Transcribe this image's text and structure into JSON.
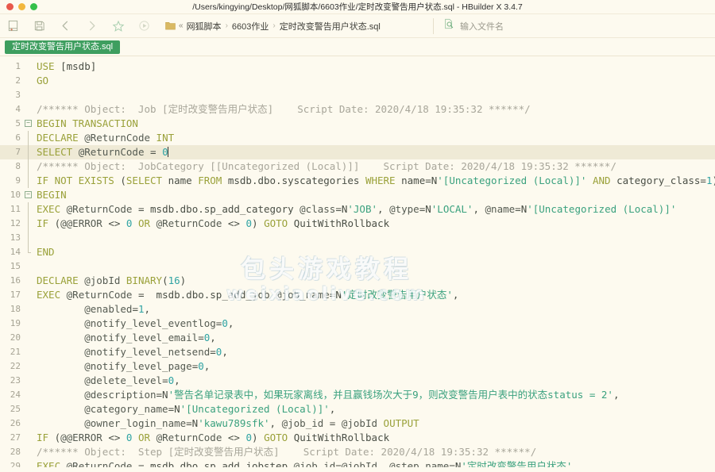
{
  "window": {
    "title": "/Users/kingying/Desktop/网狐脚本/6603作业/定时改变警告用户状态.sql - HBuilder X 3.4.7",
    "traffic_lights": [
      "close",
      "minimize",
      "zoom"
    ],
    "colors": {
      "close": "#e8584b",
      "minimize": "#f2b73d",
      "zoom": "#35c04a",
      "background": "#fdfaef",
      "tab_accent": "#3e9e5f",
      "current_line": "#efead6"
    }
  },
  "toolbar": {
    "buttons": [
      {
        "name": "new-file-icon",
        "label": "新建"
      },
      {
        "name": "save-icon",
        "label": "保存"
      },
      {
        "name": "back-arrow-icon",
        "label": "后退"
      },
      {
        "name": "forward-arrow-icon",
        "label": "前进"
      },
      {
        "name": "star-icon",
        "label": "收藏"
      },
      {
        "name": "run-icon",
        "label": "运行"
      }
    ],
    "breadcrumb": {
      "folder_icon": "folder-icon",
      "guillemet": "«",
      "separator": "›",
      "items": [
        "网狐脚本",
        "6603作业",
        "定时改变警告用户状态.sql"
      ]
    },
    "search": {
      "icon": "file-search-icon",
      "placeholder": "输入文件名",
      "value": ""
    }
  },
  "tabs": [
    {
      "label": "定时改变警告用户状态.sql",
      "active": true
    }
  ],
  "watermark": {
    "line1": "包头游戏教程",
    "line2": "weixiaolive.com"
  },
  "editor": {
    "current_line": 7,
    "cursor_line": 7,
    "lines": [
      {
        "n": 1,
        "fold": "none",
        "tokens": [
          {
            "t": "kw",
            "s": "USE"
          },
          {
            "t": "plain",
            "s": " [msdb]"
          }
        ]
      },
      {
        "n": 2,
        "fold": "none",
        "tokens": [
          {
            "t": "kw",
            "s": "GO"
          }
        ]
      },
      {
        "n": 3,
        "fold": "none",
        "tokens": []
      },
      {
        "n": 4,
        "fold": "none",
        "tokens": [
          {
            "t": "cmt",
            "s": "/****** Object:  Job [定时改变警告用户状态]    Script Date: 2020/4/18 19:35:32 ******/"
          }
        ]
      },
      {
        "n": 5,
        "fold": "open",
        "tokens": [
          {
            "t": "kw",
            "s": "BEGIN TRANSACTION"
          }
        ]
      },
      {
        "n": 6,
        "fold": "bar",
        "tokens": [
          {
            "t": "kw",
            "s": "DECLARE"
          },
          {
            "t": "plain",
            "s": " "
          },
          {
            "t": "var",
            "s": "@ReturnCode"
          },
          {
            "t": "plain",
            "s": " "
          },
          {
            "t": "kw",
            "s": "INT"
          }
        ]
      },
      {
        "n": 7,
        "fold": "bar",
        "tokens": [
          {
            "t": "kw",
            "s": "SELECT"
          },
          {
            "t": "plain",
            "s": " "
          },
          {
            "t": "var",
            "s": "@ReturnCode"
          },
          {
            "t": "plain",
            "s": " = "
          },
          {
            "t": "num",
            "s": "0"
          }
        ],
        "caret": true
      },
      {
        "n": 8,
        "fold": "bar",
        "tokens": [
          {
            "t": "cmt",
            "s": "/****** Object:  JobCategory [[Uncategorized (Local)]]    Script Date: 2020/4/18 19:35:32 ******/"
          }
        ]
      },
      {
        "n": 9,
        "fold": "bar",
        "tokens": [
          {
            "t": "kw",
            "s": "IF NOT EXISTS"
          },
          {
            "t": "plain",
            "s": " ("
          },
          {
            "t": "kw",
            "s": "SELECT"
          },
          {
            "t": "plain",
            "s": " name "
          },
          {
            "t": "kw",
            "s": "FROM"
          },
          {
            "t": "plain",
            "s": " msdb.dbo.syscategories "
          },
          {
            "t": "kw",
            "s": "WHERE"
          },
          {
            "t": "plain",
            "s": " name=N"
          },
          {
            "t": "str",
            "s": "'[Uncategorized (Local)]'"
          },
          {
            "t": "plain",
            "s": " "
          },
          {
            "t": "kw",
            "s": "AND"
          },
          {
            "t": "plain",
            "s": " category_class="
          },
          {
            "t": "num",
            "s": "1"
          },
          {
            "t": "plain",
            "s": ")"
          }
        ]
      },
      {
        "n": 10,
        "fold": "open",
        "tokens": [
          {
            "t": "kw",
            "s": "BEGIN"
          }
        ]
      },
      {
        "n": 11,
        "fold": "bar",
        "tokens": [
          {
            "t": "kw",
            "s": "EXEC"
          },
          {
            "t": "plain",
            "s": " "
          },
          {
            "t": "var",
            "s": "@ReturnCode"
          },
          {
            "t": "plain",
            "s": " = msdb.dbo.sp_add_category "
          },
          {
            "t": "var",
            "s": "@class"
          },
          {
            "t": "plain",
            "s": "=N"
          },
          {
            "t": "str",
            "s": "'JOB'"
          },
          {
            "t": "plain",
            "s": ", "
          },
          {
            "t": "var",
            "s": "@type"
          },
          {
            "t": "plain",
            "s": "=N"
          },
          {
            "t": "str",
            "s": "'LOCAL'"
          },
          {
            "t": "plain",
            "s": ", "
          },
          {
            "t": "var",
            "s": "@name"
          },
          {
            "t": "plain",
            "s": "=N"
          },
          {
            "t": "str",
            "s": "'[Uncategorized (Local)]'"
          }
        ]
      },
      {
        "n": 12,
        "fold": "bar",
        "tokens": [
          {
            "t": "kw",
            "s": "IF"
          },
          {
            "t": "plain",
            "s": " ("
          },
          {
            "t": "var",
            "s": "@@ERROR"
          },
          {
            "t": "plain",
            "s": " <> "
          },
          {
            "t": "num",
            "s": "0"
          },
          {
            "t": "plain",
            "s": " "
          },
          {
            "t": "kw",
            "s": "OR"
          },
          {
            "t": "plain",
            "s": " "
          },
          {
            "t": "var",
            "s": "@ReturnCode"
          },
          {
            "t": "plain",
            "s": " <> "
          },
          {
            "t": "num",
            "s": "0"
          },
          {
            "t": "plain",
            "s": ") "
          },
          {
            "t": "kw",
            "s": "GOTO"
          },
          {
            "t": "plain",
            "s": " QuitWithRollback"
          }
        ]
      },
      {
        "n": 13,
        "fold": "bar",
        "tokens": []
      },
      {
        "n": 14,
        "fold": "end",
        "tokens": [
          {
            "t": "kw",
            "s": "END"
          }
        ]
      },
      {
        "n": 15,
        "fold": "none",
        "tokens": []
      },
      {
        "n": 16,
        "fold": "none",
        "tokens": [
          {
            "t": "kw",
            "s": "DECLARE"
          },
          {
            "t": "plain",
            "s": " "
          },
          {
            "t": "var",
            "s": "@jobId"
          },
          {
            "t": "plain",
            "s": " "
          },
          {
            "t": "kw",
            "s": "BINARY"
          },
          {
            "t": "plain",
            "s": "("
          },
          {
            "t": "num",
            "s": "16"
          },
          {
            "t": "plain",
            "s": ")"
          }
        ]
      },
      {
        "n": 17,
        "fold": "none",
        "tokens": [
          {
            "t": "kw",
            "s": "EXEC"
          },
          {
            "t": "plain",
            "s": " "
          },
          {
            "t": "var",
            "s": "@ReturnCode"
          },
          {
            "t": "plain",
            "s": " =  msdb.dbo.sp_add_job "
          },
          {
            "t": "var",
            "s": "@job_name"
          },
          {
            "t": "plain",
            "s": "=N"
          },
          {
            "t": "str",
            "s": "'定时改变警告用户状态'"
          },
          {
            "t": "plain",
            "s": ","
          }
        ]
      },
      {
        "n": 18,
        "fold": "none",
        "tokens": [
          {
            "t": "plain",
            "s": "        "
          },
          {
            "t": "var",
            "s": "@enabled"
          },
          {
            "t": "plain",
            "s": "="
          },
          {
            "t": "num",
            "s": "1"
          },
          {
            "t": "plain",
            "s": ","
          }
        ]
      },
      {
        "n": 19,
        "fold": "none",
        "tokens": [
          {
            "t": "plain",
            "s": "        "
          },
          {
            "t": "var",
            "s": "@notify_level_eventlog"
          },
          {
            "t": "plain",
            "s": "="
          },
          {
            "t": "num",
            "s": "0"
          },
          {
            "t": "plain",
            "s": ","
          }
        ]
      },
      {
        "n": 20,
        "fold": "none",
        "tokens": [
          {
            "t": "plain",
            "s": "        "
          },
          {
            "t": "var",
            "s": "@notify_level_email"
          },
          {
            "t": "plain",
            "s": "="
          },
          {
            "t": "num",
            "s": "0"
          },
          {
            "t": "plain",
            "s": ","
          }
        ]
      },
      {
        "n": 21,
        "fold": "none",
        "tokens": [
          {
            "t": "plain",
            "s": "        "
          },
          {
            "t": "var",
            "s": "@notify_level_netsend"
          },
          {
            "t": "plain",
            "s": "="
          },
          {
            "t": "num",
            "s": "0"
          },
          {
            "t": "plain",
            "s": ","
          }
        ]
      },
      {
        "n": 22,
        "fold": "none",
        "tokens": [
          {
            "t": "plain",
            "s": "        "
          },
          {
            "t": "var",
            "s": "@notify_level_page"
          },
          {
            "t": "plain",
            "s": "="
          },
          {
            "t": "num",
            "s": "0"
          },
          {
            "t": "plain",
            "s": ","
          }
        ]
      },
      {
        "n": 23,
        "fold": "none",
        "tokens": [
          {
            "t": "plain",
            "s": "        "
          },
          {
            "t": "var",
            "s": "@delete_level"
          },
          {
            "t": "plain",
            "s": "="
          },
          {
            "t": "num",
            "s": "0"
          },
          {
            "t": "plain",
            "s": ","
          }
        ]
      },
      {
        "n": 24,
        "fold": "none",
        "tokens": [
          {
            "t": "plain",
            "s": "        "
          },
          {
            "t": "var",
            "s": "@description"
          },
          {
            "t": "plain",
            "s": "=N"
          },
          {
            "t": "str",
            "s": "'警告名单记录表中，如果玩家离线，并且赢钱场次大于9，则改变警告用户表中的状态status = 2'"
          },
          {
            "t": "plain",
            "s": ","
          }
        ]
      },
      {
        "n": 25,
        "fold": "none",
        "tokens": [
          {
            "t": "plain",
            "s": "        "
          },
          {
            "t": "var",
            "s": "@category_name"
          },
          {
            "t": "plain",
            "s": "=N"
          },
          {
            "t": "str",
            "s": "'[Uncategorized (Local)]'"
          },
          {
            "t": "plain",
            "s": ","
          }
        ]
      },
      {
        "n": 26,
        "fold": "none",
        "tokens": [
          {
            "t": "plain",
            "s": "        "
          },
          {
            "t": "var",
            "s": "@owner_login_name"
          },
          {
            "t": "plain",
            "s": "=N"
          },
          {
            "t": "str",
            "s": "'kawu789sfk'"
          },
          {
            "t": "plain",
            "s": ", "
          },
          {
            "t": "var",
            "s": "@job_id"
          },
          {
            "t": "plain",
            "s": " = "
          },
          {
            "t": "var",
            "s": "@jobId"
          },
          {
            "t": "plain",
            "s": " "
          },
          {
            "t": "kw",
            "s": "OUTPUT"
          }
        ]
      },
      {
        "n": 27,
        "fold": "none",
        "tokens": [
          {
            "t": "kw",
            "s": "IF"
          },
          {
            "t": "plain",
            "s": " ("
          },
          {
            "t": "var",
            "s": "@@ERROR"
          },
          {
            "t": "plain",
            "s": " <> "
          },
          {
            "t": "num",
            "s": "0"
          },
          {
            "t": "plain",
            "s": " "
          },
          {
            "t": "kw",
            "s": "OR"
          },
          {
            "t": "plain",
            "s": " "
          },
          {
            "t": "var",
            "s": "@ReturnCode"
          },
          {
            "t": "plain",
            "s": " <> "
          },
          {
            "t": "num",
            "s": "0"
          },
          {
            "t": "plain",
            "s": ") "
          },
          {
            "t": "kw",
            "s": "GOTO"
          },
          {
            "t": "plain",
            "s": " QuitWithRollback"
          }
        ]
      },
      {
        "n": 28,
        "fold": "none",
        "tokens": [
          {
            "t": "cmt",
            "s": "/****** Object:  Step [定时改变警告用户状态]    Script Date: 2020/4/18 19:35:32 ******/"
          }
        ]
      },
      {
        "n": 29,
        "fold": "none",
        "tokens": [
          {
            "t": "kw",
            "s": "EXEC"
          },
          {
            "t": "plain",
            "s": " "
          },
          {
            "t": "var",
            "s": "@ReturnCode"
          },
          {
            "t": "plain",
            "s": " = msdb.dbo.sp_add_jobstep "
          },
          {
            "t": "var",
            "s": "@job_id"
          },
          {
            "t": "plain",
            "s": "="
          },
          {
            "t": "var",
            "s": "@jobId"
          },
          {
            "t": "plain",
            "s": ", "
          },
          {
            "t": "var",
            "s": "@step_name"
          },
          {
            "t": "plain",
            "s": "=N"
          },
          {
            "t": "str",
            "s": "'定时改变警告用户状态'"
          }
        ]
      }
    ]
  }
}
